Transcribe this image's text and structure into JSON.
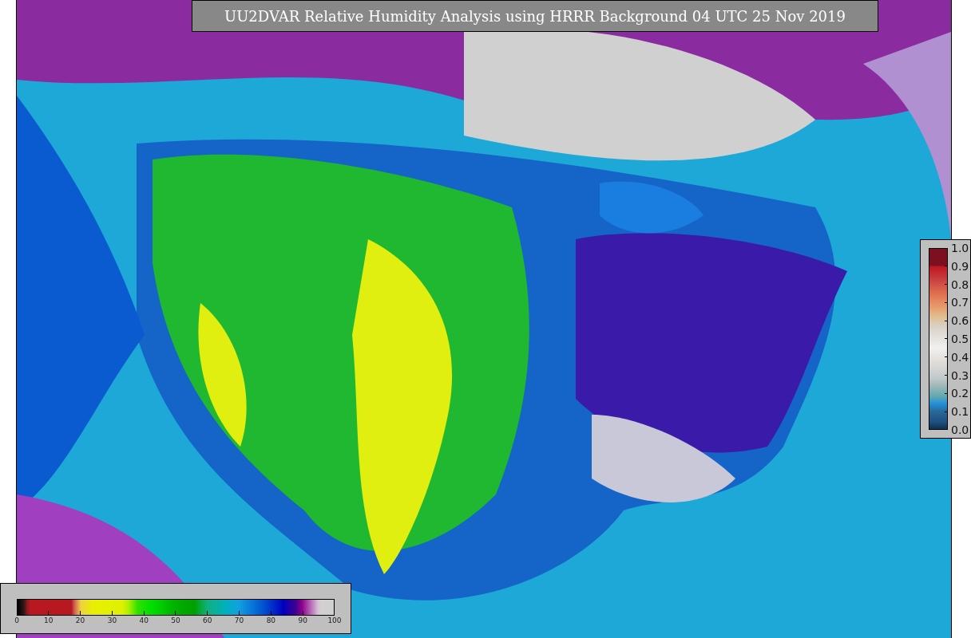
{
  "title": "UU2DVAR Relative Humidity Analysis using HRRR Background 04 UTC 25 Nov 2019",
  "side_colorbar": {
    "ticks": [
      "1.0",
      "0.9",
      "0.8",
      "0.7",
      "0.6",
      "0.5",
      "0.4",
      "0.3",
      "0.2",
      "0.1",
      "0.0"
    ]
  },
  "bottom_colorbar": {
    "ticks": [
      "0",
      "10",
      "20",
      "30",
      "40",
      "50",
      "60",
      "70",
      "80",
      "90",
      "100"
    ]
  }
}
